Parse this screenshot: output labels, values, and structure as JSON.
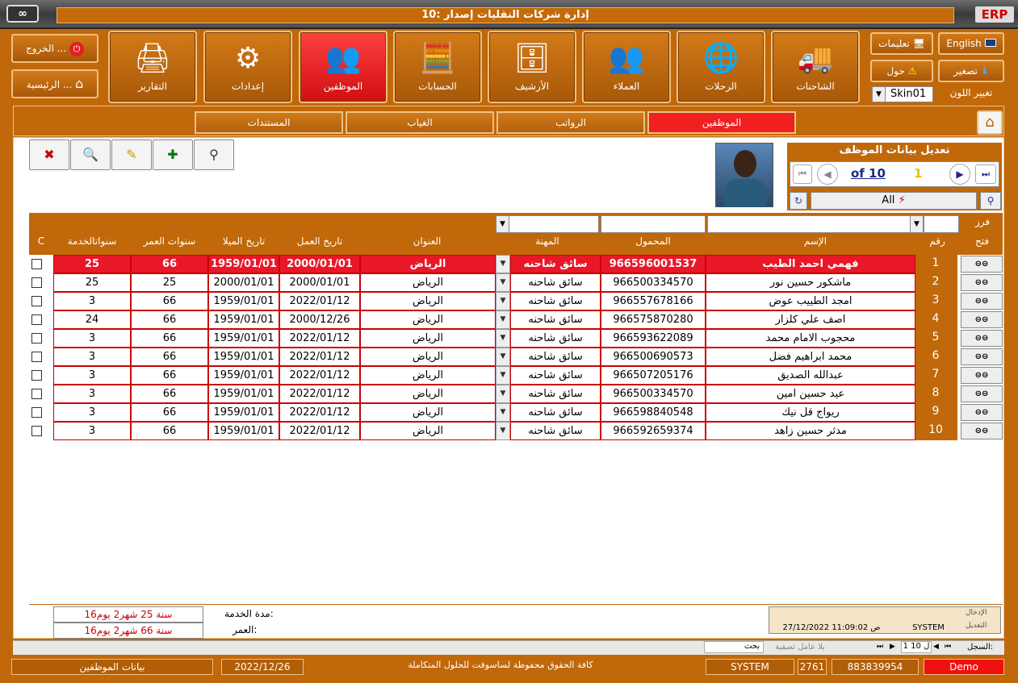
{
  "window": {
    "title": "إدارة شركات النقليات إصدار :10",
    "logo_right": "ERP",
    "logo_left": "∞"
  },
  "top_right": {
    "english": "English",
    "instructions": "تعليمات",
    "minimize": "تصغير",
    "about": "حول",
    "change_color": "تغيير اللون",
    "skin": "Skin01"
  },
  "top_left": {
    "exit": "الخروج ...",
    "home": "الرئيسية ..."
  },
  "modules": [
    {
      "label": "الشاحنات",
      "icon": "truck-icon"
    },
    {
      "label": "الرحلات",
      "icon": "globe-icon"
    },
    {
      "label": "العملاء",
      "icon": "clients-icon"
    },
    {
      "label": "الأرشيف",
      "icon": "archive-icon"
    },
    {
      "label": "الحسابات",
      "icon": "calculator-icon"
    },
    {
      "label": "الموظفين",
      "icon": "employees-icon"
    },
    {
      "label": "إعدادات",
      "icon": "gears-icon"
    },
    {
      "label": "التقارير",
      "icon": "printer-icon"
    }
  ],
  "tabs": [
    "الموظفين",
    "الرواتب",
    "الغياب",
    "المستندات"
  ],
  "nav": {
    "title": "تعديل بيانات الموظف",
    "of": "of 10",
    "current": "1",
    "filter": "All"
  },
  "columns": {
    "open": "فتح",
    "sort": "فرز",
    "num": "رقم",
    "name": "الإسم",
    "mobile": "المحمول",
    "job": "المهنة",
    "address": "العنوان",
    "work_date": "تاريخ العمل",
    "birth_date": "تاريخ الميلا",
    "age_years": "سنوات العمر",
    "service_years": "سنواتالخدمة",
    "c": "C"
  },
  "rows": [
    {
      "n": "1",
      "name": "فهمي احمد الطيب",
      "mobile": "966596001537",
      "job": "سائق شاحنه",
      "addr": "الرياض",
      "work": "2000/01/01",
      "birth": "1959/01/01",
      "age": "66",
      "svc": "25"
    },
    {
      "n": "2",
      "name": "ماشكور حسين نور",
      "mobile": "966500334570",
      "job": "سائق شاحنه",
      "addr": "الرياض",
      "work": "2000/01/01",
      "birth": "2000/01/01",
      "age": "25",
      "svc": "25"
    },
    {
      "n": "3",
      "name": "امجد الطييب عوض",
      "mobile": "966557678166",
      "job": "سائق شاحنه",
      "addr": "الرياض",
      "work": "2022/01/12",
      "birth": "1959/01/01",
      "age": "66",
      "svc": "3"
    },
    {
      "n": "4",
      "name": "اصف علي كلزار",
      "mobile": "966575870280",
      "job": "سائق شاحنه",
      "addr": "الرياض",
      "work": "2000/12/26",
      "birth": "1959/01/01",
      "age": "66",
      "svc": "24"
    },
    {
      "n": "5",
      "name": "محجوب الامام محمد",
      "mobile": "966593622089",
      "job": "سائق شاحنه",
      "addr": "الرياض",
      "work": "2022/01/12",
      "birth": "1959/01/01",
      "age": "66",
      "svc": "3"
    },
    {
      "n": "6",
      "name": "محمد ابراهيم فضل",
      "mobile": "966500690573",
      "job": "سائق شاحنه",
      "addr": "الرياض",
      "work": "2022/01/12",
      "birth": "1959/01/01",
      "age": "66",
      "svc": "3"
    },
    {
      "n": "7",
      "name": "عبدالله الصديق",
      "mobile": "966507205176",
      "job": "سائق شاحنه",
      "addr": "الرياض",
      "work": "2022/01/12",
      "birth": "1959/01/01",
      "age": "66",
      "svc": "3"
    },
    {
      "n": "8",
      "name": "عيد حسين امين",
      "mobile": "966500334570",
      "job": "سائق شاحنه",
      "addr": "الرياض",
      "work": "2022/01/12",
      "birth": "1959/01/01",
      "age": "66",
      "svc": "3"
    },
    {
      "n": "9",
      "name": "ريواج قل نيك",
      "mobile": "966598840548",
      "job": "سائق شاحنه",
      "addr": "الرياض",
      "work": "2022/01/12",
      "birth": "1959/01/01",
      "age": "66",
      "svc": "3"
    },
    {
      "n": "10",
      "name": "مدثر حسين زاهد",
      "mobile": "966592659374",
      "job": "سائق شاحنه",
      "addr": "الرياض",
      "work": "2022/01/12",
      "birth": "1959/01/01",
      "age": "66",
      "svc": "3"
    }
  ],
  "summary": {
    "service_label": "مدة الخدمة:",
    "age_label": "العمر:",
    "service_value": "سنة 25 شهر2 يوم16",
    "age_value": "سنة 66 شهر2 يوم16"
  },
  "audit": {
    "entry": "الإدخال",
    "edit": "التعديل",
    "user": "SYSTEM",
    "datetime": "27/12/2022 11:09:02 ص"
  },
  "recnav": {
    "label": "السجل:",
    "pos": "1 ل 10",
    "nofilter": "بلا عامل تصفية",
    "search": "بحث"
  },
  "status": {
    "form": "بيانات الموظفين",
    "date": "2022/12/26",
    "copyright": "كافة الحقوق محفوظة لساسوفت للحلول المتكاملة",
    "user": "SYSTEM",
    "n1": "2761",
    "n2": "883839954",
    "mode": "Demo"
  }
}
